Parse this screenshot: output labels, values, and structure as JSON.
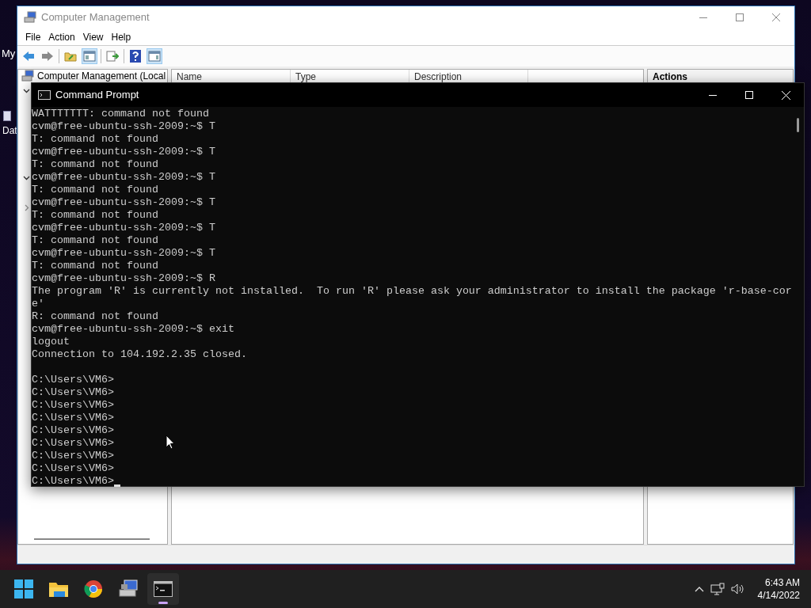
{
  "desktop": {
    "icons": [
      {
        "label": "My"
      },
      {
        "label": "Dat"
      }
    ]
  },
  "computer_management": {
    "title": "Computer Management",
    "menu": [
      "File",
      "Action",
      "View",
      "Help"
    ],
    "toolbar": [
      {
        "kind": "back",
        "pressed": false
      },
      {
        "kind": "forward",
        "pressed": false
      },
      {
        "kind": "sep"
      },
      {
        "kind": "up",
        "pressed": false
      },
      {
        "kind": "tree",
        "pressed": true
      },
      {
        "kind": "sep"
      },
      {
        "kind": "export",
        "pressed": false
      },
      {
        "kind": "sep"
      },
      {
        "kind": "help",
        "pressed": false
      },
      {
        "kind": "pane",
        "pressed": true
      }
    ],
    "tree": {
      "root": "Computer Management (Local",
      "nodes": [
        {
          "expanded": true
        },
        {
          "expanded": true
        },
        {
          "expanded": false
        }
      ]
    },
    "columns": [
      "Name",
      "Type",
      "Description"
    ],
    "actions_title": "Actions"
  },
  "command_prompt": {
    "title": "Command Prompt",
    "lines": [
      {
        "text": "WATTTTTTT: command not found"
      },
      {
        "text": "cvm@free-ubuntu-ssh-2009:~$ T"
      },
      {
        "text": "T: command not found"
      },
      {
        "text": "cvm@free-ubuntu-ssh-2009:~$ T"
      },
      {
        "text": "T: command not found"
      },
      {
        "text": "cvm@free-ubuntu-ssh-2009:~$ T"
      },
      {
        "text": "T: command not found"
      },
      {
        "text": "cvm@free-ubuntu-ssh-2009:~$ T"
      },
      {
        "text": "T: command not found"
      },
      {
        "text": "cvm@free-ubuntu-ssh-2009:~$ T"
      },
      {
        "text": "T: command not found"
      },
      {
        "text": "cvm@free-ubuntu-ssh-2009:~$ T"
      },
      {
        "text": "T: command not found"
      },
      {
        "text": "cvm@free-ubuntu-ssh-2009:~$ R"
      },
      {
        "text": "The program 'R' is currently not installed.  To run 'R' please ask your administrator to install the package 'r-base-cor"
      },
      {
        "text": "e'"
      },
      {
        "text": "R: command not found"
      },
      {
        "text": "cvm@free-ubuntu-ssh-2009:~$ exit"
      },
      {
        "text": "logout"
      },
      {
        "text": "Connection to 104.192.2.35 closed."
      },
      {
        "text": "C:\\Users\\VM6>",
        "gap_before": true
      },
      {
        "text": "C:\\Users\\VM6>"
      },
      {
        "text": "C:\\Users\\VM6>"
      },
      {
        "text": "C:\\Users\\VM6>"
      },
      {
        "text": "C:\\Users\\VM6>"
      },
      {
        "text": "C:\\Users\\VM6>"
      },
      {
        "text": "C:\\Users\\VM6>"
      },
      {
        "text": "C:\\Users\\VM6>"
      },
      {
        "text": "C:\\Users\\VM6>",
        "cursor": true
      }
    ]
  },
  "taskbar": {
    "apps": [
      {
        "kind": "start",
        "selected": false
      },
      {
        "kind": "explorer",
        "selected": false
      },
      {
        "kind": "chrome",
        "selected": false
      },
      {
        "kind": "compmgmt",
        "selected": false
      },
      {
        "kind": "terminal",
        "selected": true
      }
    ],
    "time": "6:43 AM",
    "date": "4/14/2022"
  }
}
